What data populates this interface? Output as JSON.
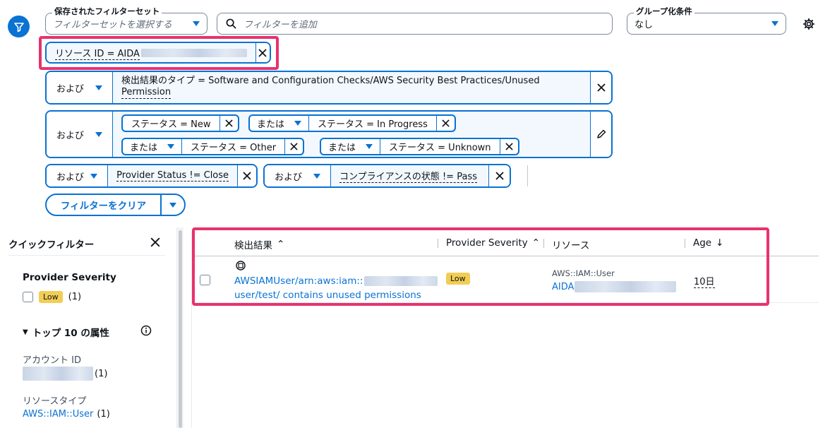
{
  "toolbar": {
    "saved_filter_label": "保存されたフィルターセット",
    "saved_filter_placeholder": "フィルターセットを選択する",
    "search_placeholder": "フィルターを追加",
    "group_by_label": "グループ化条件",
    "group_by_value": "なし"
  },
  "filters": {
    "resource_id_token": "リソース ID = AIDA",
    "row1": {
      "op": "および",
      "text_line1": "検出結果のタイプ = Software and Configuration Checks/AWS Security Best Practices/Unused",
      "text_line2": "Permission"
    },
    "row2": {
      "op": "および",
      "status_new": "ステータス = New",
      "or1": "または",
      "status_in_progress": "ステータス = In Progress",
      "or2": "または",
      "status_other": "ステータス = Other",
      "or3": "または",
      "status_unknown": "ステータス = Unknown"
    },
    "row3": {
      "op1": "および",
      "provider_status": "Provider Status != Close",
      "op2": "および",
      "compliance": "コンプライアンスの状態 != Pass"
    },
    "clear_label": "フィルターをクリア"
  },
  "side_panel": {
    "title": "クイックフィルター",
    "severity_heading": "Provider Severity",
    "severity_badge": "Low",
    "severity_count": "(1)",
    "top_attrs_heading": "トップ 10 の属性",
    "account_id_label": "アカウント ID",
    "account_id_count": "(1)",
    "resource_type_label": "リソースタイプ",
    "resource_type_value": "AWS::IAM::User",
    "resource_type_count": "(1)"
  },
  "table": {
    "columns": [
      "検出結果",
      "Provider Severity",
      "リソース",
      "Age"
    ],
    "row": {
      "finding_line1": "AWSIAMUser/arn:aws:iam::",
      "finding_line2": "user/test/ contains unused permissions",
      "severity": "Low",
      "resource_type": "AWS::IAM::User",
      "resource_id": "AIDA",
      "age": "10日"
    }
  },
  "colors": {
    "accent": "#0972d3",
    "highlight": "#e8336d",
    "badge_low": "#f2cd54"
  }
}
